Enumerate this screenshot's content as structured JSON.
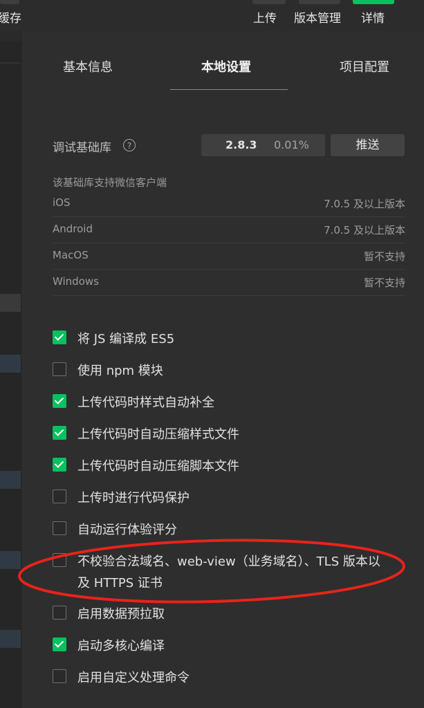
{
  "toolbar": {
    "left_partial_label": "缓存",
    "upload_label": "上传",
    "version_mgmt_label": "版本管理",
    "details_label": "详情",
    "details_accent": "#07c160"
  },
  "tabs": [
    {
      "label": "基本信息",
      "active": false
    },
    {
      "label": "本地设置",
      "active": true
    },
    {
      "label": "项目配置",
      "active": false
    }
  ],
  "debug_lib": {
    "label": "调试基础库",
    "help_icon": "question-circle-icon",
    "version": "2.8.3",
    "percent": "0.01%",
    "push_label": "推送"
  },
  "support": {
    "title": "该基础库支持微信客户端",
    "platforms": [
      {
        "name": "iOS",
        "value": "7.0.5 及以上版本"
      },
      {
        "name": "Android",
        "value": "7.0.5 及以上版本"
      },
      {
        "name": "MacOS",
        "value": "暂不支持"
      },
      {
        "name": "Windows",
        "value": "暂不支持"
      }
    ]
  },
  "options": [
    {
      "label": "将 JS 编译成 ES5",
      "checked": true
    },
    {
      "label": "使用 npm 模块",
      "checked": false
    },
    {
      "label": "上传代码时样式自动补全",
      "checked": true
    },
    {
      "label": "上传代码时自动压缩样式文件",
      "checked": true
    },
    {
      "label": "上传代码时自动压缩脚本文件",
      "checked": true
    },
    {
      "label": "上传时进行代码保护",
      "checked": false
    },
    {
      "label": "自动运行体验评分",
      "checked": false
    },
    {
      "label": "不校验合法域名、web-view（业务域名）、TLS 版本以及 HTTPS 证书",
      "checked": false
    },
    {
      "label": "启用数据预拉取",
      "checked": false
    },
    {
      "label": "启动多核心编译",
      "checked": true
    },
    {
      "label": "启用自定义处理命令",
      "checked": false
    }
  ],
  "colors": {
    "checked": "#07c160",
    "annotation": "#e8231b",
    "panel_bg": "#2e2e2e"
  }
}
